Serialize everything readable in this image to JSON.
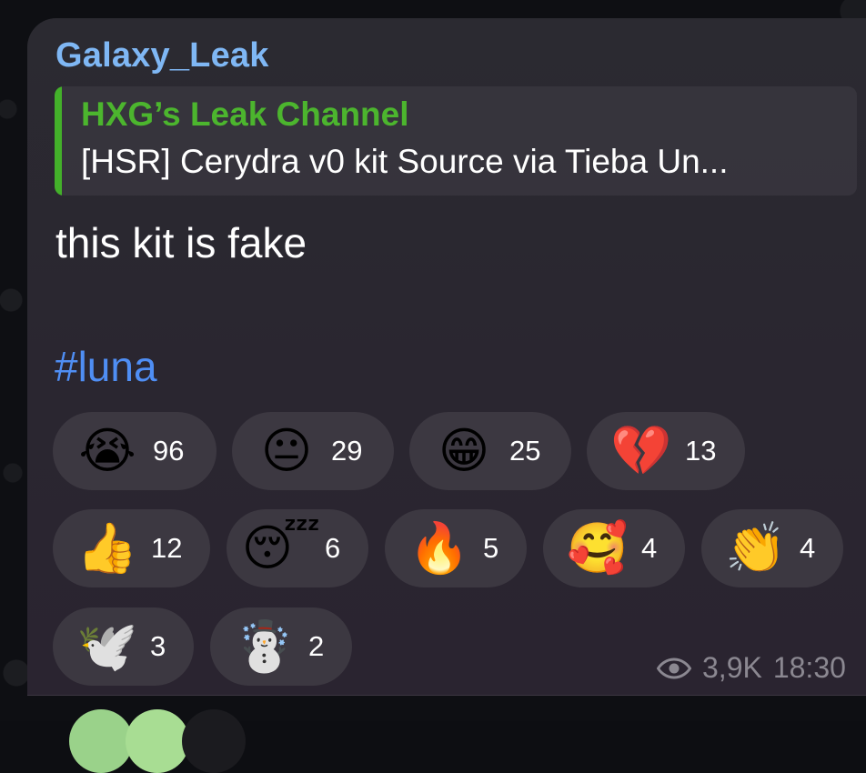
{
  "message": {
    "sender": "Galaxy_Leak",
    "reply": {
      "title": "HXG’s Leak Channel",
      "text": "[HSR] Cerydra v0 kit Source via Tieba Un..."
    },
    "text": "this kit is fake",
    "hashtag": "#luna",
    "views": "3,9K",
    "time": "18:30"
  },
  "reactions": [
    {
      "emoji": "😭",
      "icon": "loudly-crying-face-icon",
      "count": "96"
    },
    {
      "emoji": "😐",
      "icon": "neutral-face-icon",
      "count": "29"
    },
    {
      "emoji": "😁",
      "icon": "beaming-face-icon",
      "count": "25"
    },
    {
      "emoji": "💔",
      "icon": "broken-heart-icon",
      "count": "13"
    },
    {
      "emoji": "👍",
      "icon": "thumbs-up-icon",
      "count": "12"
    },
    {
      "emoji": "😴",
      "icon": "sleeping-face-icon",
      "count": "6"
    },
    {
      "emoji": "🔥",
      "icon": "fire-icon",
      "count": "5"
    },
    {
      "emoji": "🥰",
      "icon": "smiling-face-with-hearts-icon",
      "count": "4"
    },
    {
      "emoji": "👏",
      "icon": "clapping-hands-icon",
      "count": "4"
    },
    {
      "emoji": "🕊️",
      "icon": "dove-icon",
      "count": "3"
    },
    {
      "emoji": "☃️",
      "icon": "snowman-icon",
      "count": "2"
    }
  ],
  "colors": {
    "sender": "#7fb7f4",
    "reply_accent": "#43b02a",
    "hashtag": "#4f8ef4",
    "reaction_bg": "#3c3841",
    "meta": "#8b8891"
  }
}
